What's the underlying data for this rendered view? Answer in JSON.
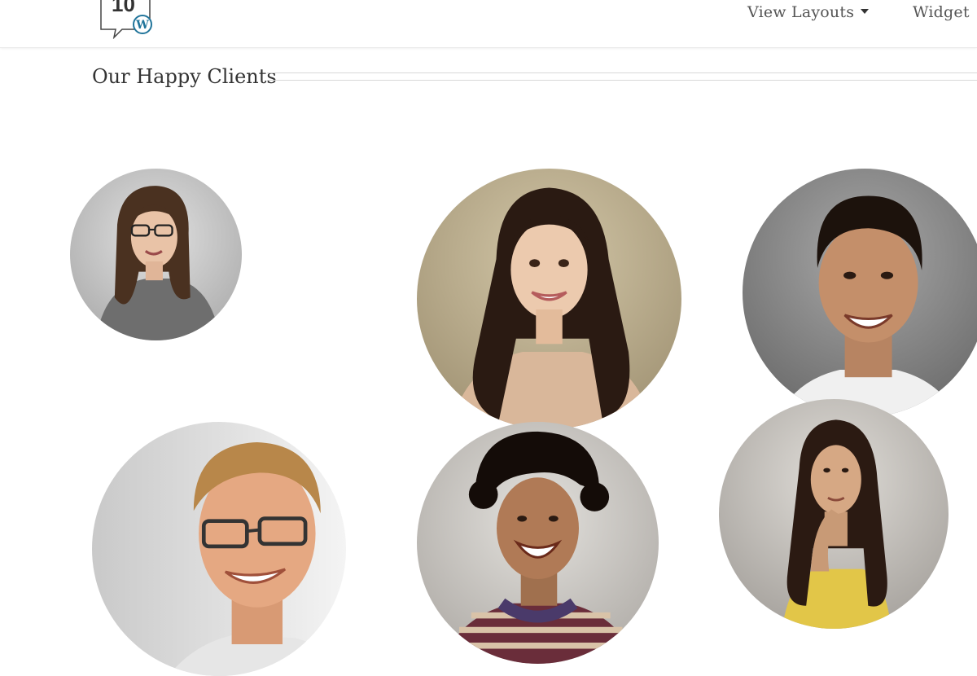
{
  "header": {
    "logo": {
      "text": "10",
      "badge": "W"
    },
    "nav": [
      {
        "label": "View Layouts",
        "has_dropdown": true
      },
      {
        "label": "Widget"
      }
    ]
  },
  "section": {
    "title": "Our Happy Clients"
  },
  "clients": [
    {
      "avatar": "woman-glasses-photo"
    },
    {
      "avatar": "woman-long-hair-photo"
    },
    {
      "avatar": "man-smiling-photo"
    },
    {
      "avatar": "man-glasses-photo"
    },
    {
      "avatar": "man-curly-hair-photo"
    },
    {
      "avatar": "woman-thinking-photo"
    }
  ],
  "colors": {
    "text": "#333333",
    "nav_text": "#555555",
    "divider": "#d8d8d8",
    "wp_blue": "#21759b"
  }
}
